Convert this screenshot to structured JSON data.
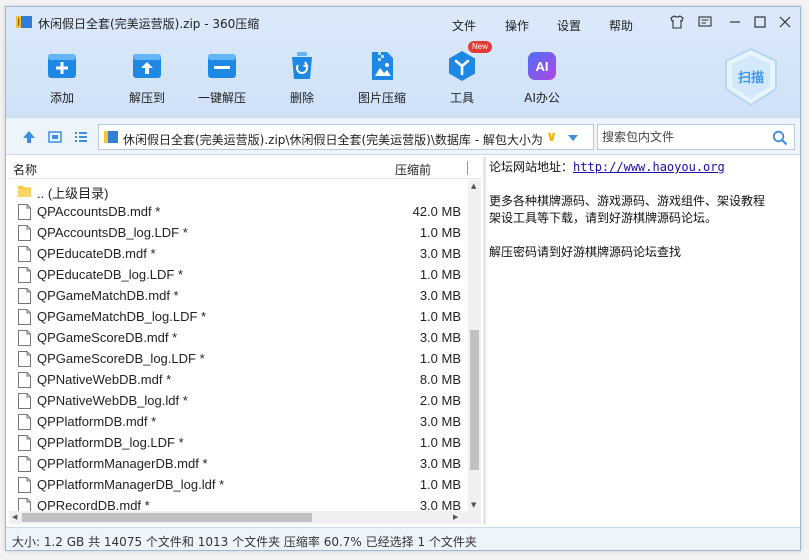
{
  "window": {
    "title": "休闲假日全套(完美运营版).zip - 360压缩",
    "menu": [
      "文件",
      "操作",
      "设置",
      "帮助"
    ]
  },
  "toolbar": {
    "items": [
      {
        "label": "添加",
        "icon": "add-icon"
      },
      {
        "label": "解压到",
        "icon": "extract-to-icon"
      },
      {
        "label": "一键解压",
        "icon": "one-click-extract-icon"
      },
      {
        "label": "删除",
        "icon": "delete-icon"
      },
      {
        "label": "图片压缩",
        "icon": "image-compress-icon"
      },
      {
        "label": "工具",
        "icon": "tools-icon",
        "badge": "New"
      },
      {
        "label": "AI办公",
        "icon": "ai-office-icon",
        "icon_text": "AI"
      }
    ],
    "scan_label": "扫描"
  },
  "address": {
    "path": "休闲假日全套(完美运营版).zip\\休闲假日全套(完美运营版)\\数据库 - 解包大小为",
    "search_placeholder": "搜索包内文件"
  },
  "filelist": {
    "columns": {
      "name": "名称",
      "size": "压缩前"
    },
    "rows": [
      {
        "name": ".. (上级目录)",
        "size": "",
        "type": "folder"
      },
      {
        "name": "QPAccountsDB.mdf *",
        "size": "42.0 MB",
        "type": "file"
      },
      {
        "name": "QPAccountsDB_log.LDF *",
        "size": "1.0 MB",
        "type": "file"
      },
      {
        "name": "QPEducateDB.mdf *",
        "size": "3.0 MB",
        "type": "file"
      },
      {
        "name": "QPEducateDB_log.LDF *",
        "size": "1.0 MB",
        "type": "file"
      },
      {
        "name": "QPGameMatchDB.mdf *",
        "size": "3.0 MB",
        "type": "file"
      },
      {
        "name": "QPGameMatchDB_log.LDF *",
        "size": "1.0 MB",
        "type": "file"
      },
      {
        "name": "QPGameScoreDB.mdf *",
        "size": "3.0 MB",
        "type": "file"
      },
      {
        "name": "QPGameScoreDB_log.LDF *",
        "size": "1.0 MB",
        "type": "file"
      },
      {
        "name": "QPNativeWebDB.mdf *",
        "size": "8.0 MB",
        "type": "file"
      },
      {
        "name": "QPNativeWebDB_log.ldf *",
        "size": "2.0 MB",
        "type": "file"
      },
      {
        "name": "QPPlatformDB.mdf *",
        "size": "3.0 MB",
        "type": "file"
      },
      {
        "name": "QPPlatformDB_log.LDF *",
        "size": "1.0 MB",
        "type": "file"
      },
      {
        "name": "QPPlatformManagerDB.mdf *",
        "size": "3.0 MB",
        "type": "file"
      },
      {
        "name": "QPPlatformManagerDB_log.ldf *",
        "size": "1.0 MB",
        "type": "file"
      },
      {
        "name": "QPRecordDB.mdf *",
        "size": "3.0 MB",
        "type": "file"
      }
    ]
  },
  "comment": {
    "site_label": "论坛网站地址：",
    "site_url": "http://www.haoyou.org",
    "line2": "更多各种棋牌源码、游戏源码、游戏组件、架设教程",
    "line3": "架设工具等下载，请到好游棋牌源码论坛。",
    "line4": "解压密码请到好游棋牌源码论坛查找"
  },
  "status": {
    "text": "大小: 1.2 GB 共 14075 个文件和 1013 个文件夹 压缩率 60.7% 已经选择 1 个文件夹"
  },
  "colors": {
    "accent": "#1e88e5",
    "topbar": "#d6e7fa",
    "badge": "#e53935"
  }
}
